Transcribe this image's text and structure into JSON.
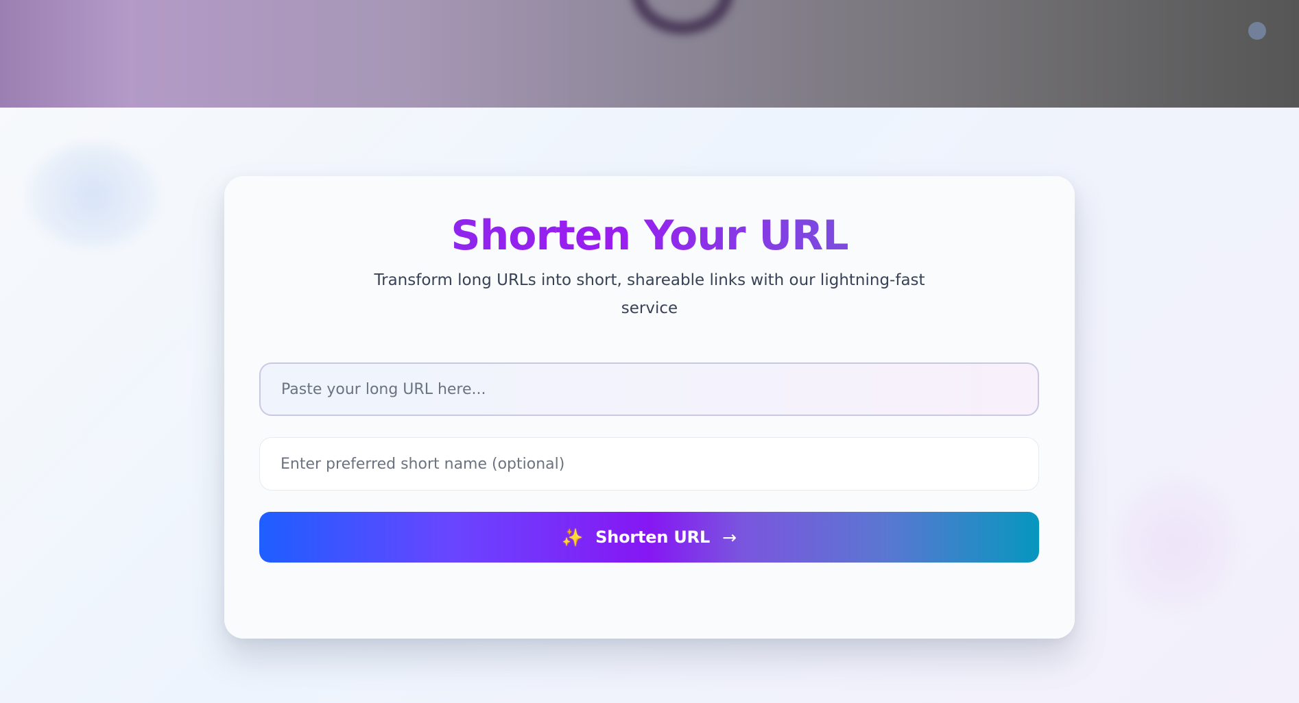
{
  "hero": {
    "ring_icon": "ring-shape",
    "dot_icon": "status-dot"
  },
  "card": {
    "title": "Shorten Your URL",
    "subtitle": "Transform long URLs into short, shareable links with our lightning-fast service"
  },
  "form": {
    "url_placeholder": "Paste your long URL here...",
    "url_value": "",
    "short_name_placeholder": "Enter preferred short name (optional)",
    "short_name_value": "",
    "button_label": "Shorten URL",
    "button_icon": "sparkle-icon",
    "button_arrow_icon": "arrow-right-icon"
  },
  "colors": {
    "title_purple": "#9a1cf0",
    "button_start": "#1e5eff",
    "button_middle": "#8617f3",
    "button_end": "#0697be",
    "subtitle_text": "#384255"
  }
}
